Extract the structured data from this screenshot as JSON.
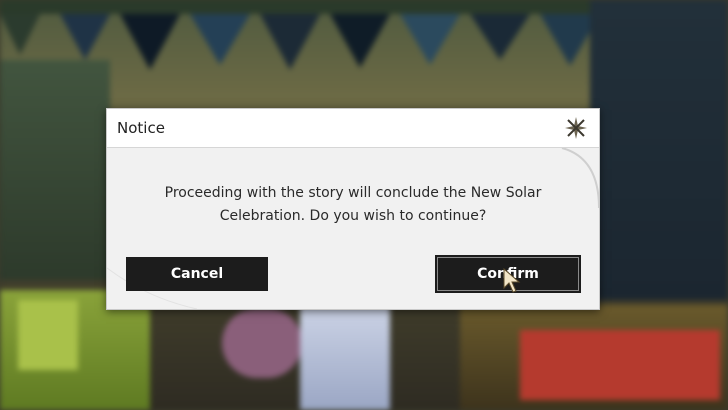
{
  "dialog": {
    "title": "Notice",
    "message": "Proceeding with the story will conclude the New Solar Celebration. Do you wish to continue?",
    "close_icon": "close-star-icon",
    "buttons": {
      "cancel_label": "Cancel",
      "confirm_label": "Confirm"
    }
  },
  "colors": {
    "button_bg": "#1c1c1c",
    "dialog_bg": "#f4f4f4",
    "text": "#2a2a2a"
  }
}
